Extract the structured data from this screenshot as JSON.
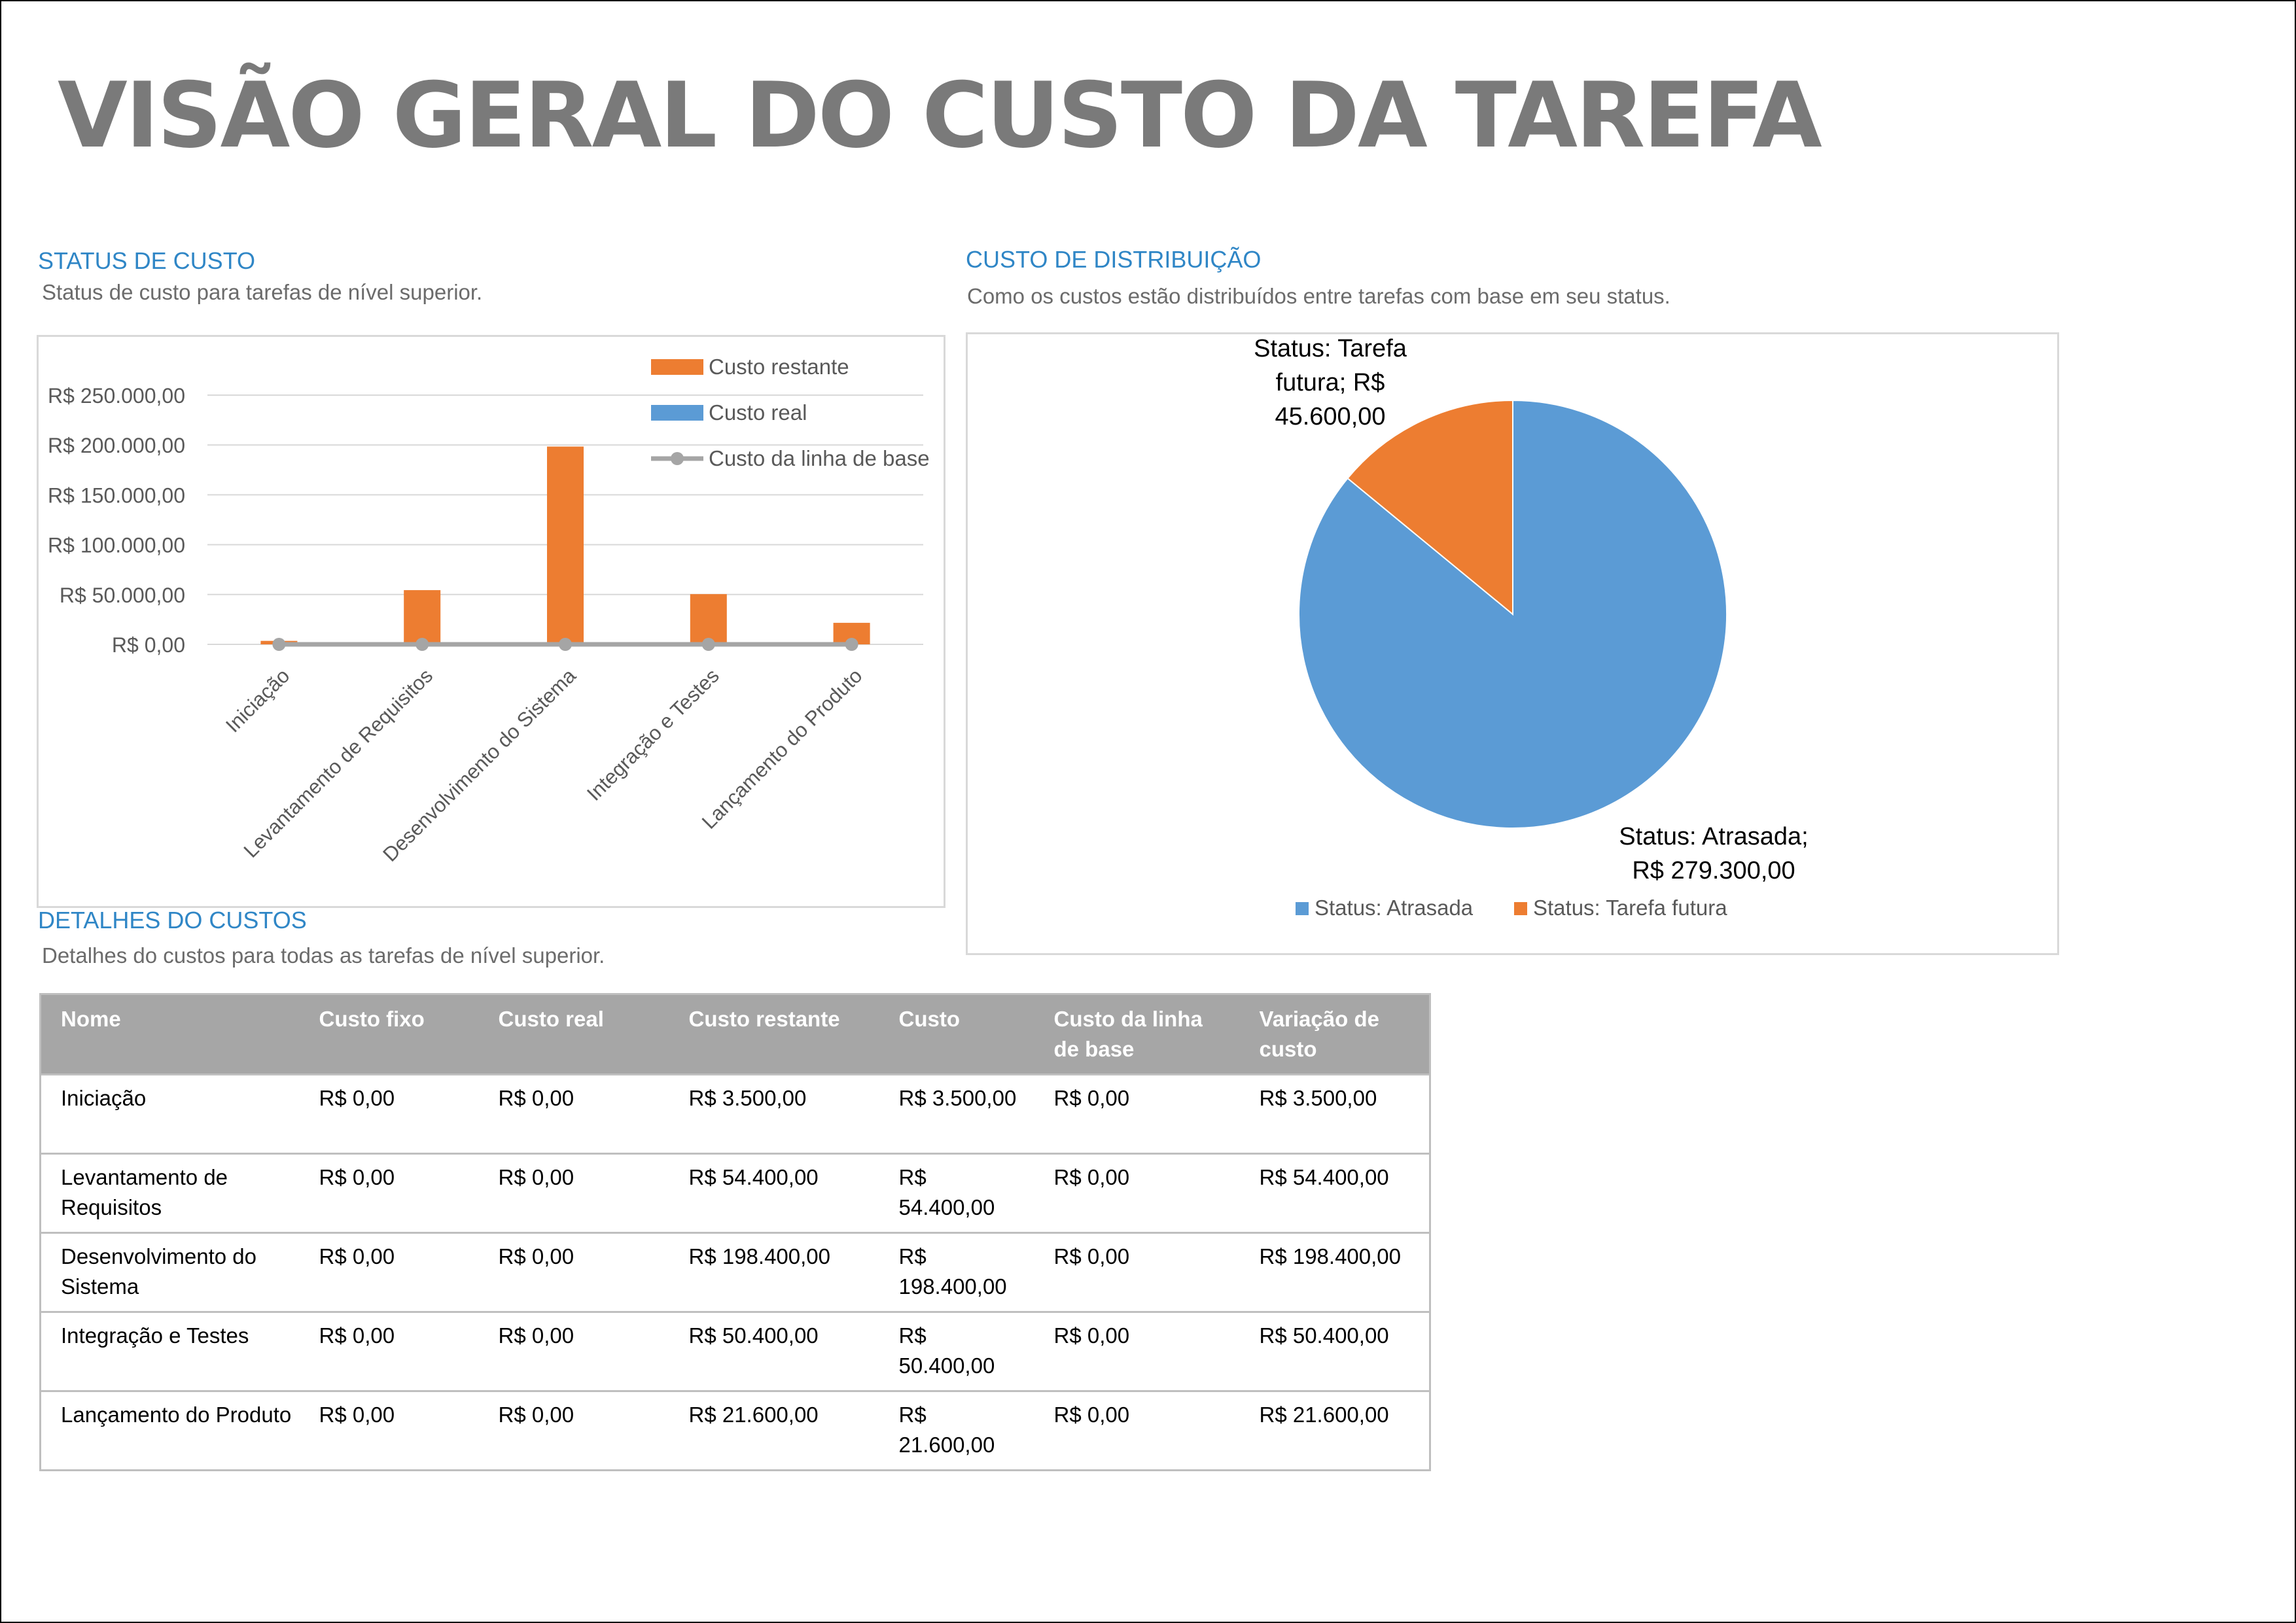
{
  "page": {
    "title": "VISÃO GERAL DO CUSTO DA TAREFA"
  },
  "status_section": {
    "title": "STATUS DE CUSTO",
    "subtitle": "Status de custo para tarefas de nível superior."
  },
  "distribution_section": {
    "title": "CUSTO DE DISTRIBUIÇÃO",
    "subtitle": "Como os custos estão distribuídos entre tarefas com base em seu status."
  },
  "details_section": {
    "title": "DETALHES DO CUSTOS",
    "subtitle": "Detalhes do custos para todas as tarefas de nível superior."
  },
  "colors": {
    "orange": "#ed7d31",
    "blue": "#5b9bd5",
    "gray_line": "#a5a5a5",
    "accent_title": "#2f86c6",
    "header_bg": "#a6a6a6"
  },
  "chart_data": [
    {
      "type": "bar",
      "categories": [
        "Iniciação",
        "Levantamento de Requisitos",
        "Desenvolvimento do Sistema",
        "Integração e Testes",
        "Lançamento do Produto"
      ],
      "series": [
        {
          "name": "Custo restante",
          "kind": "bar",
          "color": "#ed7d31",
          "values": [
            3500,
            54400,
            198400,
            50400,
            21600
          ]
        },
        {
          "name": "Custo real",
          "kind": "bar",
          "color": "#5b9bd5",
          "values": [
            0,
            0,
            0,
            0,
            0
          ]
        },
        {
          "name": "Custo da linha de base",
          "kind": "line",
          "color": "#a5a5a5",
          "values": [
            0,
            0,
            0,
            0,
            0
          ]
        }
      ],
      "yticks": [
        {
          "value": 0,
          "label": "R$ 0,00"
        },
        {
          "value": 50000,
          "label": "R$ 50.000,00"
        },
        {
          "value": 100000,
          "label": "R$ 100.000,00"
        },
        {
          "value": 150000,
          "label": "R$ 150.000,00"
        },
        {
          "value": 200000,
          "label": "R$ 200.000,00"
        },
        {
          "value": 250000,
          "label": "R$ 250.000,00"
        }
      ],
      "ylim": [
        0,
        250000
      ],
      "grid": true,
      "legend": "top-right"
    },
    {
      "type": "pie",
      "slices": [
        {
          "name": "Status: Atrasada",
          "value": 279300,
          "color": "#5b9bd5",
          "label_lines": [
            "Status: Atrasada;",
            "R$ 279.300,00"
          ]
        },
        {
          "name": "Status: Tarefa futura",
          "value": 45600,
          "color": "#ed7d31",
          "label_lines": [
            "Status: Tarefa",
            "futura; R$",
            "45.600,00"
          ]
        }
      ],
      "legend": "bottom"
    }
  ],
  "table": {
    "headers": [
      "Nome",
      "Custo fixo",
      "Custo real",
      "Custo restante",
      "Custo",
      "Custo da linha de base",
      "Variação de custo"
    ],
    "rows": [
      [
        "Iniciação",
        "R$ 0,00",
        "R$ 0,00",
        "R$ 3.500,00",
        "R$ 3.500,00",
        "R$ 0,00",
        "R$ 3.500,00"
      ],
      [
        "Levantamento de Requisitos",
        "R$ 0,00",
        "R$ 0,00",
        "R$ 54.400,00",
        "R$ 54.400,00",
        "R$ 0,00",
        "R$ 54.400,00"
      ],
      [
        "Desenvolvimento do Sistema",
        "R$ 0,00",
        "R$ 0,00",
        "R$ 198.400,00",
        "R$ 198.400,00",
        "R$ 0,00",
        "R$ 198.400,00"
      ],
      [
        "Integração e Testes",
        "R$ 0,00",
        "R$ 0,00",
        "R$ 50.400,00",
        "R$ 50.400,00",
        "R$ 0,00",
        "R$ 50.400,00"
      ],
      [
        "Lançamento do Produto",
        "R$ 0,00",
        "R$ 0,00",
        "R$ 21.600,00",
        "R$ 21.600,00",
        "R$ 0,00",
        "R$ 21.600,00"
      ]
    ]
  }
}
